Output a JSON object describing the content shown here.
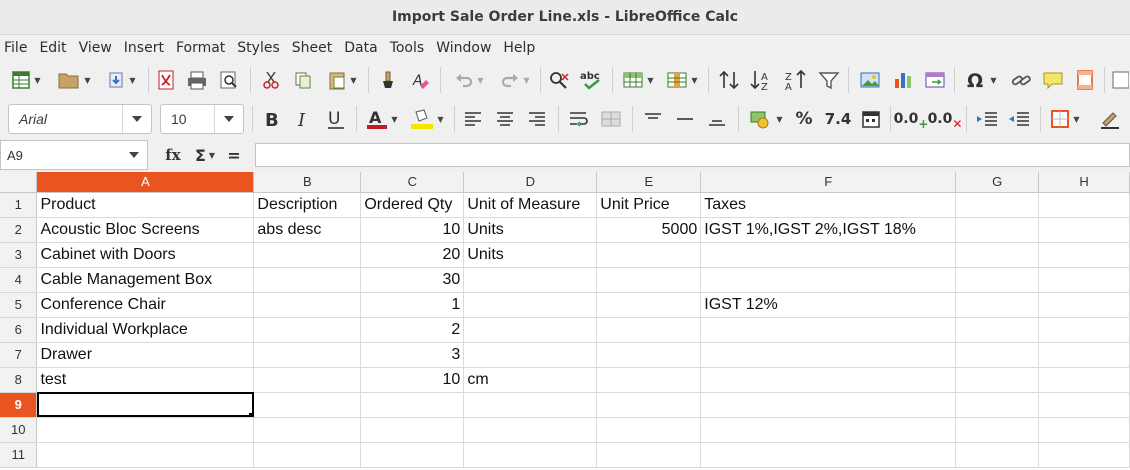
{
  "window": {
    "title": "Import Sale Order Line.xls - LibreOffice Calc"
  },
  "menu": [
    "File",
    "Edit",
    "View",
    "Insert",
    "Format",
    "Styles",
    "Sheet",
    "Data",
    "Tools",
    "Window",
    "Help"
  ],
  "format_toolbar": {
    "font_name": "Arial",
    "font_size": "10",
    "percent_label": "%",
    "number_label": "7.4",
    "add_decimal_label": "0.0",
    "remove_decimal_label": "0.0"
  },
  "formula_bar": {
    "cell_ref": "A9",
    "fx_label": "fx",
    "sum_label": "Σ",
    "equals_label": "=",
    "value": ""
  },
  "grid": {
    "active_column": "A",
    "active_row": "9",
    "columns": [
      "A",
      "B",
      "C",
      "D",
      "E",
      "F",
      "G",
      "H"
    ],
    "rows": [
      {
        "num": "1",
        "cells": [
          "Product",
          "Description",
          "Ordered Qty",
          "Unit of Measure",
          "Unit Price",
          "Taxes",
          "",
          ""
        ]
      },
      {
        "num": "2",
        "cells": [
          "Acoustic Bloc Screens",
          "abs desc",
          "10",
          "Units",
          "5000",
          "IGST 1%,IGST 2%,IGST 18%",
          "",
          ""
        ]
      },
      {
        "num": "3",
        "cells": [
          "Cabinet with Doors",
          "",
          "20",
          "Units",
          "",
          "",
          "",
          ""
        ]
      },
      {
        "num": "4",
        "cells": [
          "Cable Management Box",
          "",
          "30",
          "",
          "",
          "",
          "",
          ""
        ]
      },
      {
        "num": "5",
        "cells": [
          "Conference Chair",
          "",
          "1",
          "",
          "",
          "IGST 12%",
          "",
          ""
        ]
      },
      {
        "num": "6",
        "cells": [
          "Individual Workplace",
          "",
          "2",
          "",
          "",
          "",
          "",
          ""
        ]
      },
      {
        "num": "7",
        "cells": [
          "Drawer",
          "",
          "3",
          "",
          "",
          "",
          "",
          ""
        ]
      },
      {
        "num": "8",
        "cells": [
          "test",
          "",
          "10",
          "cm",
          "",
          "",
          "",
          ""
        ]
      },
      {
        "num": "9",
        "cells": [
          "",
          "",
          "",
          "",
          "",
          "",
          "",
          ""
        ]
      },
      {
        "num": "10",
        "cells": [
          "",
          "",
          "",
          "",
          "",
          "",
          "",
          ""
        ]
      },
      {
        "num": "11",
        "cells": [
          "",
          "",
          "",
          "",
          "",
          "",
          "",
          ""
        ]
      }
    ]
  },
  "colors": {
    "accent": "#e95420",
    "font_color": "#c01c28",
    "highlight": "#f5e600"
  }
}
